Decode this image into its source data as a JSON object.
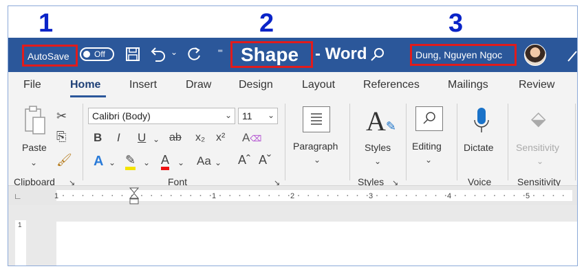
{
  "callouts": [
    "1",
    "2",
    "3"
  ],
  "titlebar": {
    "autosave_label": "AutoSave",
    "autosave_state": "Off",
    "save_icon": "save-icon",
    "undo_icon": "undo-icon",
    "redo_icon": "redo-icon",
    "doc_title": "Shape",
    "app_suffix": "- Word",
    "search_icon": "search-icon",
    "user_name": "Dung, Nguyen Ngoc",
    "accent_color": "#2b579a",
    "highlight_color": "#e21b1b"
  },
  "tabs": [
    "File",
    "Home",
    "Insert",
    "Draw",
    "Design",
    "Layout",
    "References",
    "Mailings",
    "Review"
  ],
  "ribbon": {
    "clipboard": {
      "paste_label": "Paste",
      "group_label": "Clipboard"
    },
    "font": {
      "font_name": "Calibri (Body)",
      "font_size": "11",
      "group_label": "Font",
      "bold": "B",
      "italic": "I",
      "underline": "U",
      "strike": "ab",
      "subscript": "x₂",
      "superscript": "x²",
      "text_effects": "A",
      "font_color": "A",
      "change_case": "Aa",
      "grow": "Aˆ",
      "shrink": "Aˇ"
    },
    "paragraph": {
      "label": "Paragraph"
    },
    "styles": {
      "label": "Styles",
      "group_label": "Styles"
    },
    "editing": {
      "label": "Editing"
    },
    "voice": {
      "label": "Dictate",
      "group_label": "Voice"
    },
    "sensitivity": {
      "label": "Sensitivity",
      "group_label": "Sensitivity"
    }
  },
  "ruler": {
    "numbers": [
      "1",
      "1",
      "2",
      "3",
      "4",
      "5"
    ],
    "vertical_number": "1"
  }
}
